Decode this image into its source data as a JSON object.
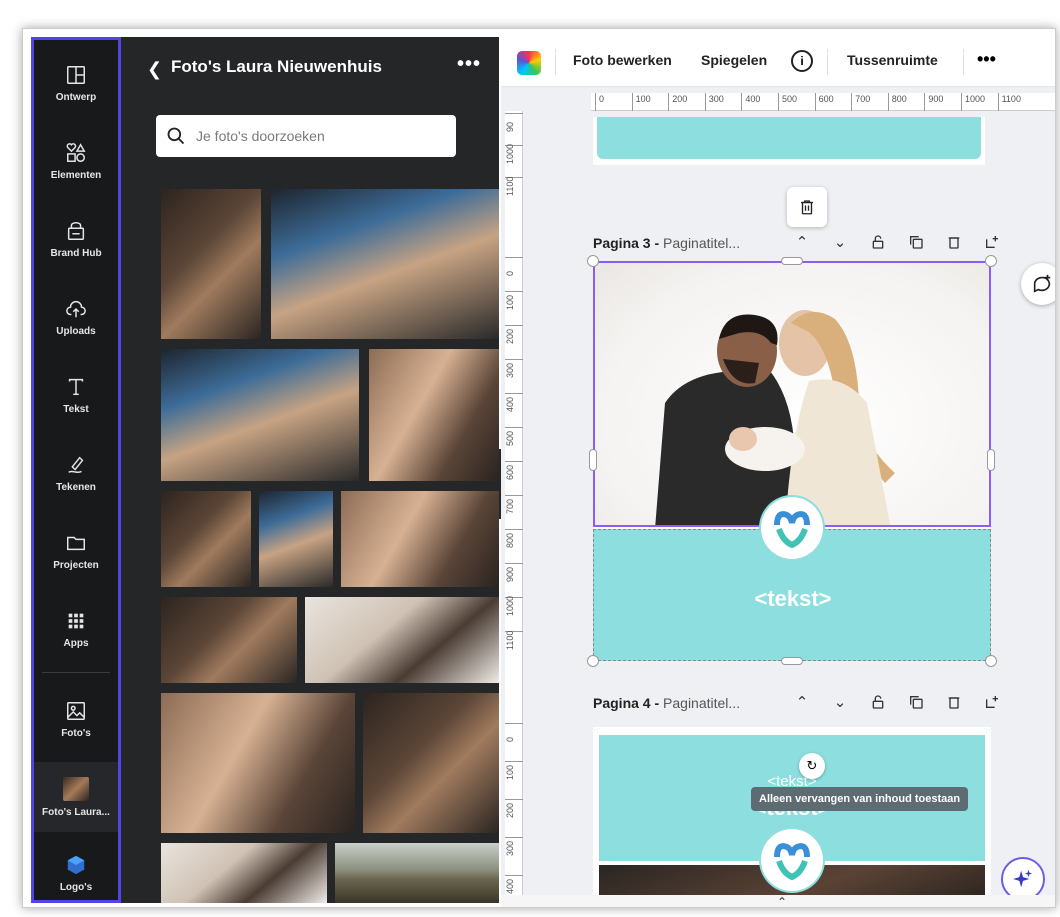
{
  "rail": {
    "items": [
      {
        "label": "Ontwerp",
        "icon": "layout-icon"
      },
      {
        "label": "Elementen",
        "icon": "shapes-icon"
      },
      {
        "label": "Brand Hub",
        "icon": "brand-hub-icon"
      },
      {
        "label": "Uploads",
        "icon": "cloud-upload-icon"
      },
      {
        "label": "Tekst",
        "icon": "text-icon"
      },
      {
        "label": "Tekenen",
        "icon": "draw-icon"
      },
      {
        "label": "Projecten",
        "icon": "folder-icon"
      },
      {
        "label": "Apps",
        "icon": "apps-grid-icon"
      },
      {
        "label": "Foto's",
        "icon": "image-icon"
      },
      {
        "label": "Foto's Laura...",
        "icon": "photo-thumb-icon"
      },
      {
        "label": "Logo's",
        "icon": "logo-icon"
      }
    ],
    "accent": "#4f46e5"
  },
  "panel": {
    "title": "Foto's Laura Nieuwenhuis",
    "more": "•••",
    "search_placeholder": "Je foto's doorzoeken"
  },
  "toolbar": {
    "edit_photo": "Foto bewerken",
    "mirror": "Spiegelen",
    "info": "i",
    "spacing": "Tussenruimte",
    "more": "•••"
  },
  "ruler": {
    "h_ticks": [
      "0",
      "100",
      "200",
      "300",
      "400",
      "500",
      "600",
      "700",
      "800",
      "900",
      "1000",
      "1100"
    ],
    "v_ticks_top": [
      "90",
      "1000",
      "1100"
    ],
    "v_ticks_page3": [
      "0",
      "100",
      "200",
      "300",
      "400",
      "500",
      "600",
      "700",
      "800",
      "900",
      "1000",
      "1100"
    ],
    "v_ticks_page4": [
      "0",
      "100",
      "200",
      "300",
      "400"
    ]
  },
  "pages": {
    "page3": {
      "label": "Pagina 3 -",
      "subtitle": "Paginatitel...",
      "text": "<tekst>"
    },
    "page4": {
      "label": "Pagina 4 -",
      "subtitle": "Paginatitel...",
      "text_small": "<tekst>",
      "text_large": "<tekst>"
    }
  },
  "tooltip": "Alleen vervangen van inhoud toestaan",
  "colors": {
    "teal": "#8ddfdf",
    "selection": "#8b5cf6",
    "rail_bg": "#18191b",
    "panel_bg": "#252627"
  }
}
